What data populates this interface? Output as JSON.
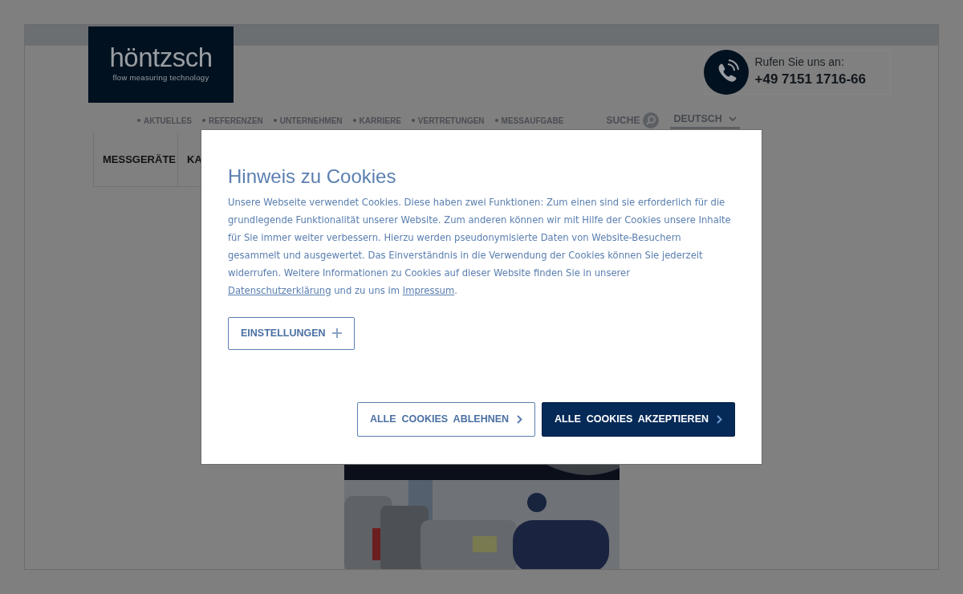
{
  "logo": {
    "name": "höntzsch",
    "tagline": "flow measuring technology"
  },
  "contact": {
    "label": "Rufen Sie uns an:",
    "phone": "+49 7151 1716-66"
  },
  "top_nav": [
    "AKTUELLES",
    "REFERENZEN",
    "UNTERNEHMEN",
    "KARRIERE",
    "VERTRETUNGEN",
    "MESSAUFGABE"
  ],
  "search": {
    "label": "SUCHE"
  },
  "language": {
    "label": "DEUTSCH"
  },
  "main_nav": [
    "MESSGERÄTE",
    "KA"
  ],
  "cookie_dialog": {
    "title": "Hinweis zu Cookies",
    "body": [
      {
        "kind": "text",
        "text": "Unsere Webseite verwendet Cookies. Diese haben zwei Funktionen: Zum einen sind sie erforderlich für die grundlegende Funktionalität unserer Website. Zum anderen können wir mit Hilfe der Cookies unsere Inhalte für Sie immer weiter verbessern. Hierzu werden pseudonymisierte Daten von Website-Besuchern gesammelt und ausgewertet. Das Einverständnis in die Verwendung der Cookies können Sie jederzeit widerrufen. Weitere Informationen zu Cookies auf dieser Website finden Sie in unserer "
      },
      {
        "kind": "link",
        "text": "Datenschutzerklärung"
      },
      {
        "kind": "text",
        "text": " und zu uns im "
      },
      {
        "kind": "link",
        "text": "Impressum"
      },
      {
        "kind": "text",
        "text": "."
      }
    ],
    "settings_button": {
      "label": "EINSTELLUNGEN",
      "expanded": false
    },
    "buttons": [
      {
        "kind": "outline",
        "label": "ALLE  COOKIES  ABLEHNEN"
      },
      {
        "kind": "primary",
        "label": "ALLE  COOKIES  AKZEPTIEREN"
      }
    ]
  }
}
